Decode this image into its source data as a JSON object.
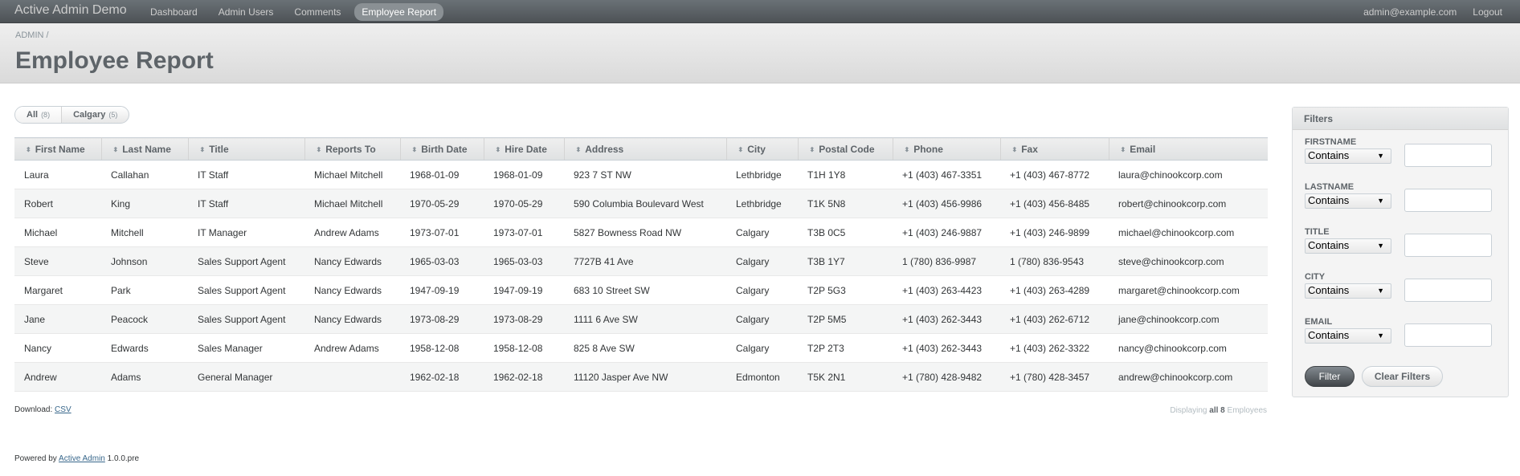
{
  "header": {
    "brand": "Active Admin Demo",
    "nav": [
      "Dashboard",
      "Admin Users",
      "Comments",
      "Employee Report"
    ],
    "active_nav": "Employee Report",
    "user_email": "admin@example.com",
    "logout": "Logout"
  },
  "titlebar": {
    "breadcrumb": "ADMIN /",
    "title": "Employee Report"
  },
  "scopes": [
    {
      "label": "All",
      "count": "(8)",
      "selected": true
    },
    {
      "label": "Calgary",
      "count": "(5)",
      "selected": false
    }
  ],
  "table": {
    "columns": [
      "First Name",
      "Last Name",
      "Title",
      "Reports To",
      "Birth Date",
      "Hire Date",
      "Address",
      "City",
      "Postal Code",
      "Phone",
      "Fax",
      "Email"
    ],
    "rows": [
      [
        "Laura",
        "Callahan",
        "IT Staff",
        "Michael Mitchell",
        "1968-01-09",
        "1968-01-09",
        "923 7 ST NW",
        "Lethbridge",
        "T1H 1Y8",
        "+1 (403) 467-3351",
        "+1 (403) 467-8772",
        "laura@chinookcorp.com"
      ],
      [
        "Robert",
        "King",
        "IT Staff",
        "Michael Mitchell",
        "1970-05-29",
        "1970-05-29",
        "590 Columbia Boulevard West",
        "Lethbridge",
        "T1K 5N8",
        "+1 (403) 456-9986",
        "+1 (403) 456-8485",
        "robert@chinookcorp.com"
      ],
      [
        "Michael",
        "Mitchell",
        "IT Manager",
        "Andrew Adams",
        "1973-07-01",
        "1973-07-01",
        "5827 Bowness Road NW",
        "Calgary",
        "T3B 0C5",
        "+1 (403) 246-9887",
        "+1 (403) 246-9899",
        "michael@chinookcorp.com"
      ],
      [
        "Steve",
        "Johnson",
        "Sales Support Agent",
        "Nancy Edwards",
        "1965-03-03",
        "1965-03-03",
        "7727B 41 Ave",
        "Calgary",
        "T3B 1Y7",
        "1 (780) 836-9987",
        "1 (780) 836-9543",
        "steve@chinookcorp.com"
      ],
      [
        "Margaret",
        "Park",
        "Sales Support Agent",
        "Nancy Edwards",
        "1947-09-19",
        "1947-09-19",
        "683 10 Street SW",
        "Calgary",
        "T2P 5G3",
        "+1 (403) 263-4423",
        "+1 (403) 263-4289",
        "margaret@chinookcorp.com"
      ],
      [
        "Jane",
        "Peacock",
        "Sales Support Agent",
        "Nancy Edwards",
        "1973-08-29",
        "1973-08-29",
        "1111 6 Ave SW",
        "Calgary",
        "T2P 5M5",
        "+1 (403) 262-3443",
        "+1 (403) 262-6712",
        "jane@chinookcorp.com"
      ],
      [
        "Nancy",
        "Edwards",
        "Sales Manager",
        "Andrew Adams",
        "1958-12-08",
        "1958-12-08",
        "825 8 Ave SW",
        "Calgary",
        "T2P 2T3",
        "+1 (403) 262-3443",
        "+1 (403) 262-3322",
        "nancy@chinookcorp.com"
      ],
      [
        "Andrew",
        "Adams",
        "General Manager",
        "",
        "1962-02-18",
        "1962-02-18",
        "11120 Jasper Ave NW",
        "Edmonton",
        "T5K 2N1",
        "+1 (780) 428-9482",
        "+1 (780) 428-3457",
        "andrew@chinookcorp.com"
      ]
    ]
  },
  "download": {
    "label": "Download:",
    "csv": "CSV"
  },
  "pagination": {
    "prefix": "Displaying",
    "all": "all 8",
    "suffix": "Employees"
  },
  "footer": {
    "prefix": "Powered by",
    "link": "Active Admin",
    "version": "1.0.0.pre"
  },
  "filters": {
    "title": "Filters",
    "fields": [
      {
        "label": "FIRSTNAME",
        "operator": "Contains",
        "value": ""
      },
      {
        "label": "LASTNAME",
        "operator": "Contains",
        "value": ""
      },
      {
        "label": "TITLE",
        "operator": "Contains",
        "value": ""
      },
      {
        "label": "CITY",
        "operator": "Contains",
        "value": ""
      },
      {
        "label": "EMAIL",
        "operator": "Contains",
        "value": ""
      }
    ],
    "filter_button": "Filter",
    "clear_button": "Clear Filters"
  }
}
